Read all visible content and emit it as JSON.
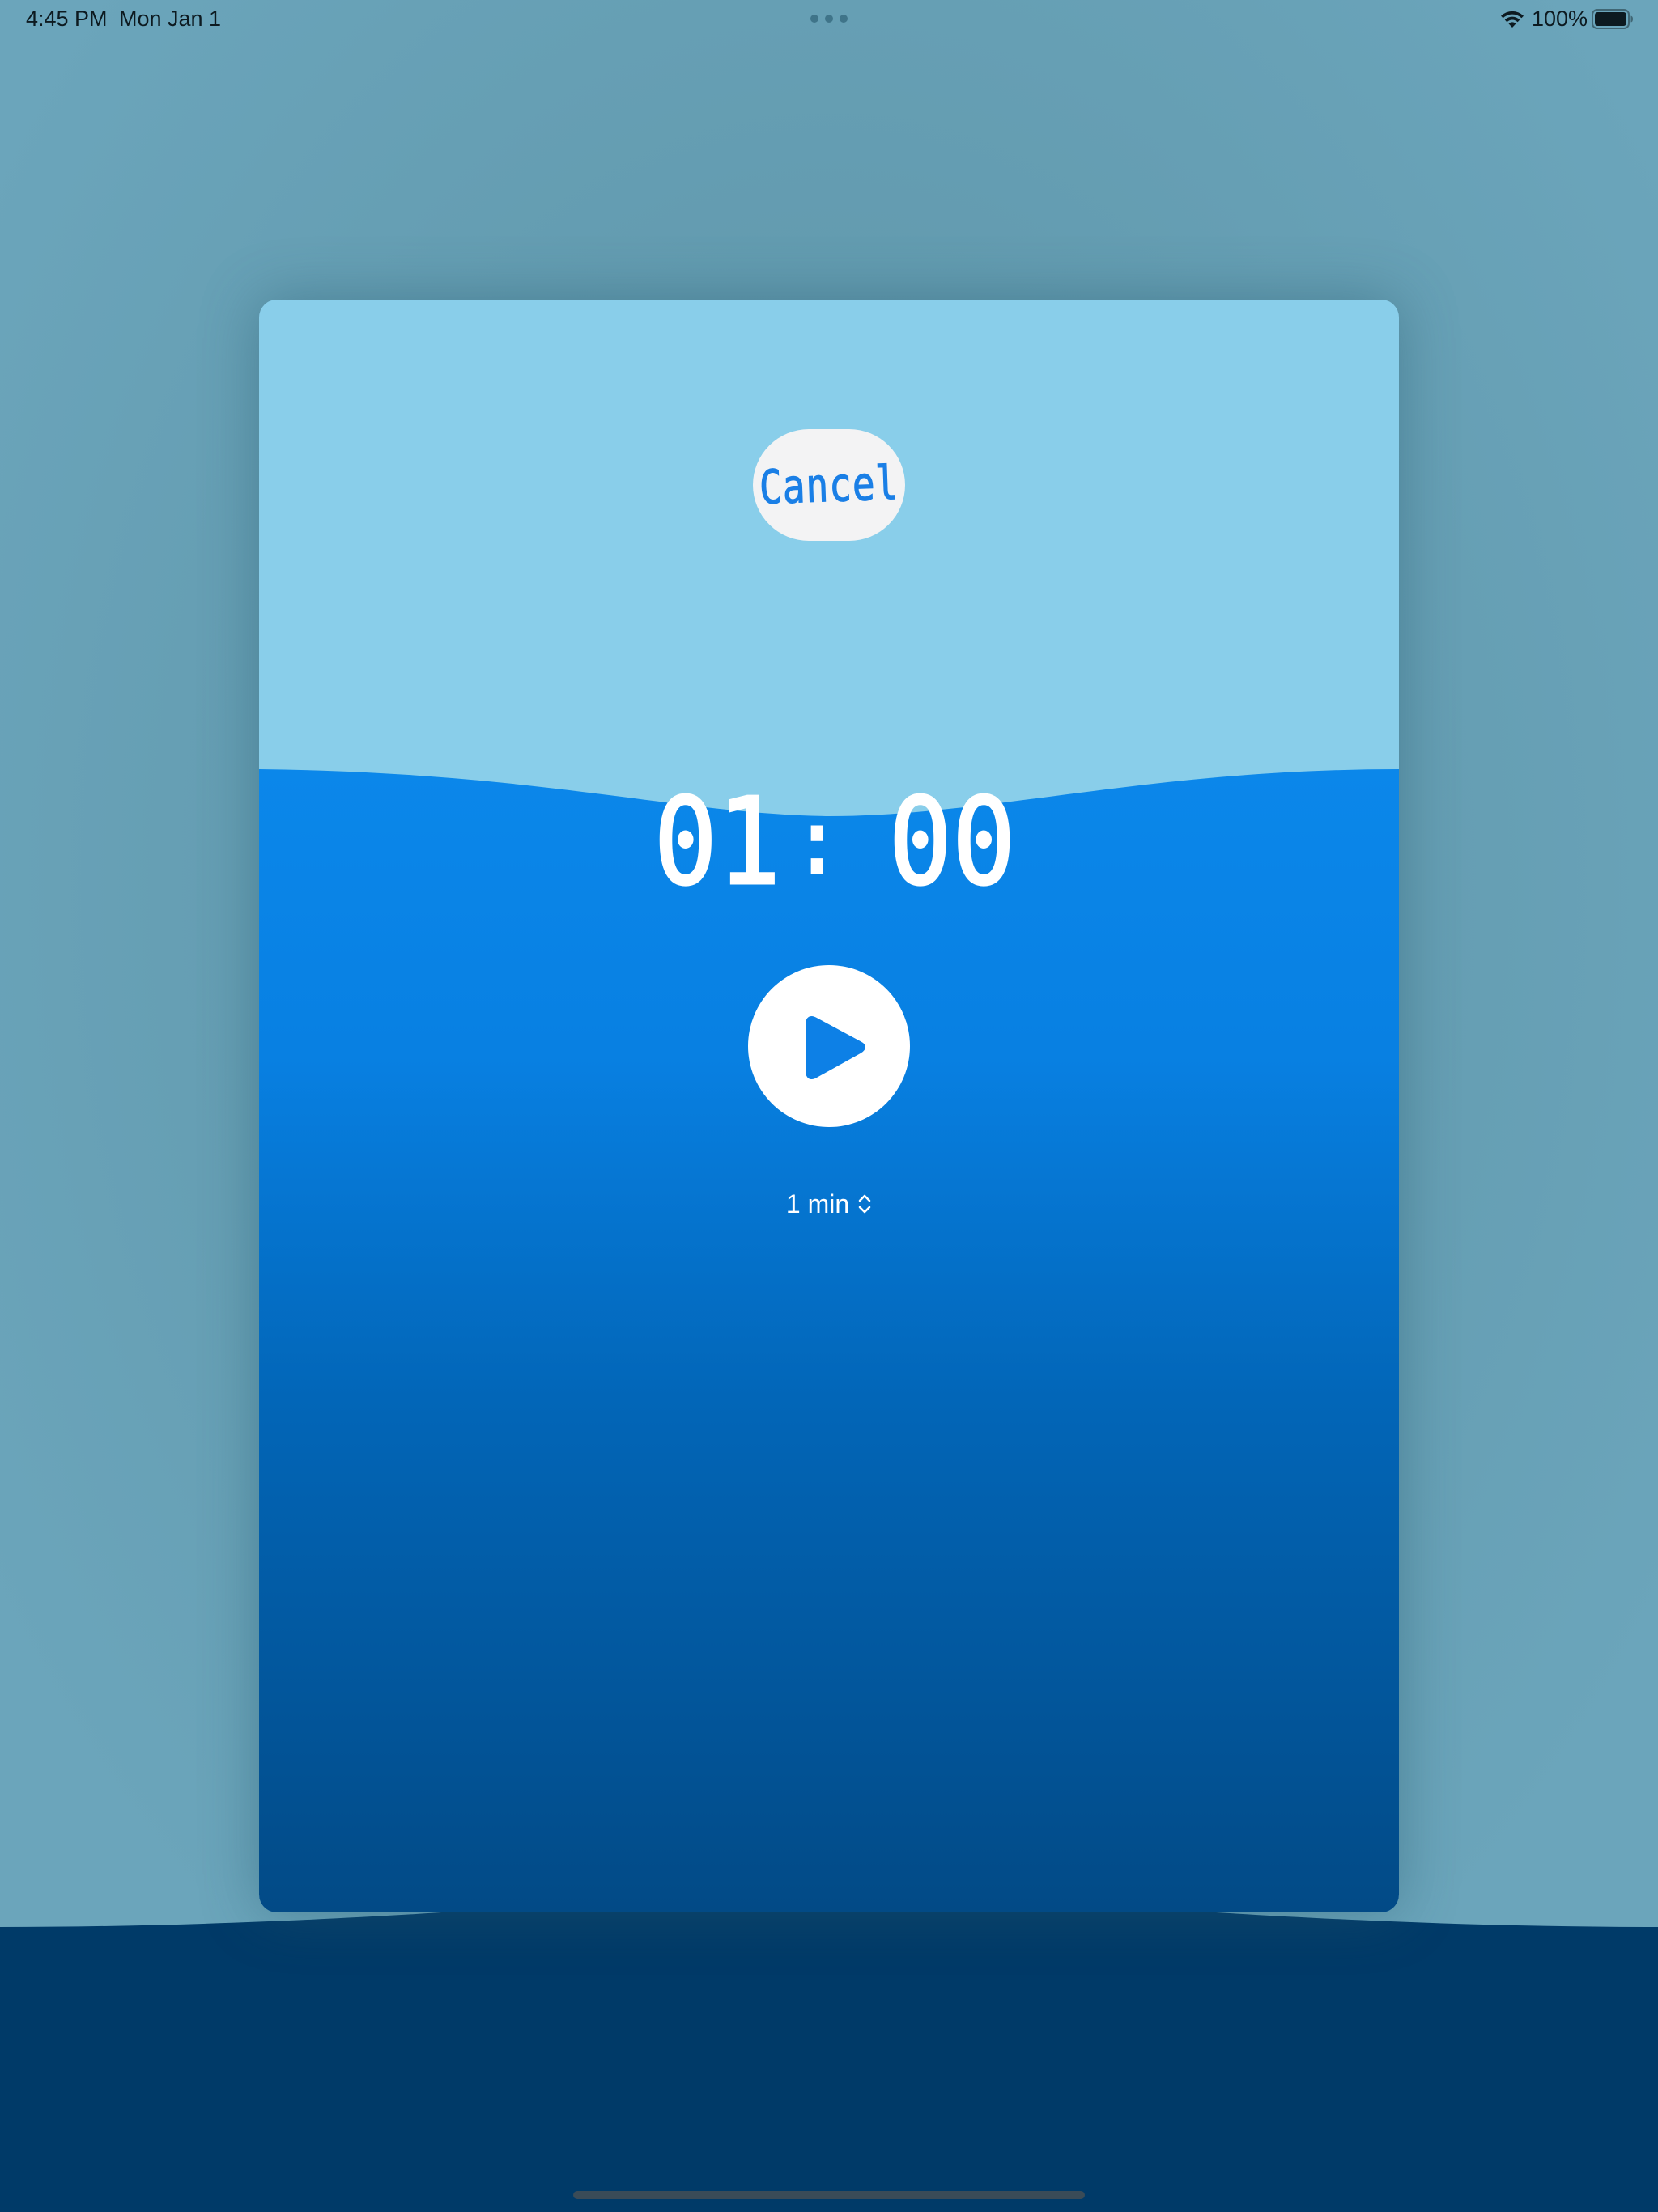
{
  "status_bar": {
    "time": "4:45 PM",
    "date": "Mon Jan 1",
    "battery": "100%"
  },
  "modal": {
    "cancel_label": "Cancel",
    "timer": {
      "minutes": "01",
      "separator": ":",
      "seconds": "00"
    },
    "duration_label": "1 min"
  },
  "icons": [
    "wifi-icon",
    "battery-icon",
    "play-icon",
    "chevron-updown-icon",
    "multitask-dots-icon"
  ],
  "colors": {
    "background": "#6aa3b9",
    "sky": "#89ceea",
    "water_top": "#0b87ea",
    "water_bottom": "#024a86",
    "deep_water": "#003a68",
    "accent": "#1a7fe6"
  }
}
